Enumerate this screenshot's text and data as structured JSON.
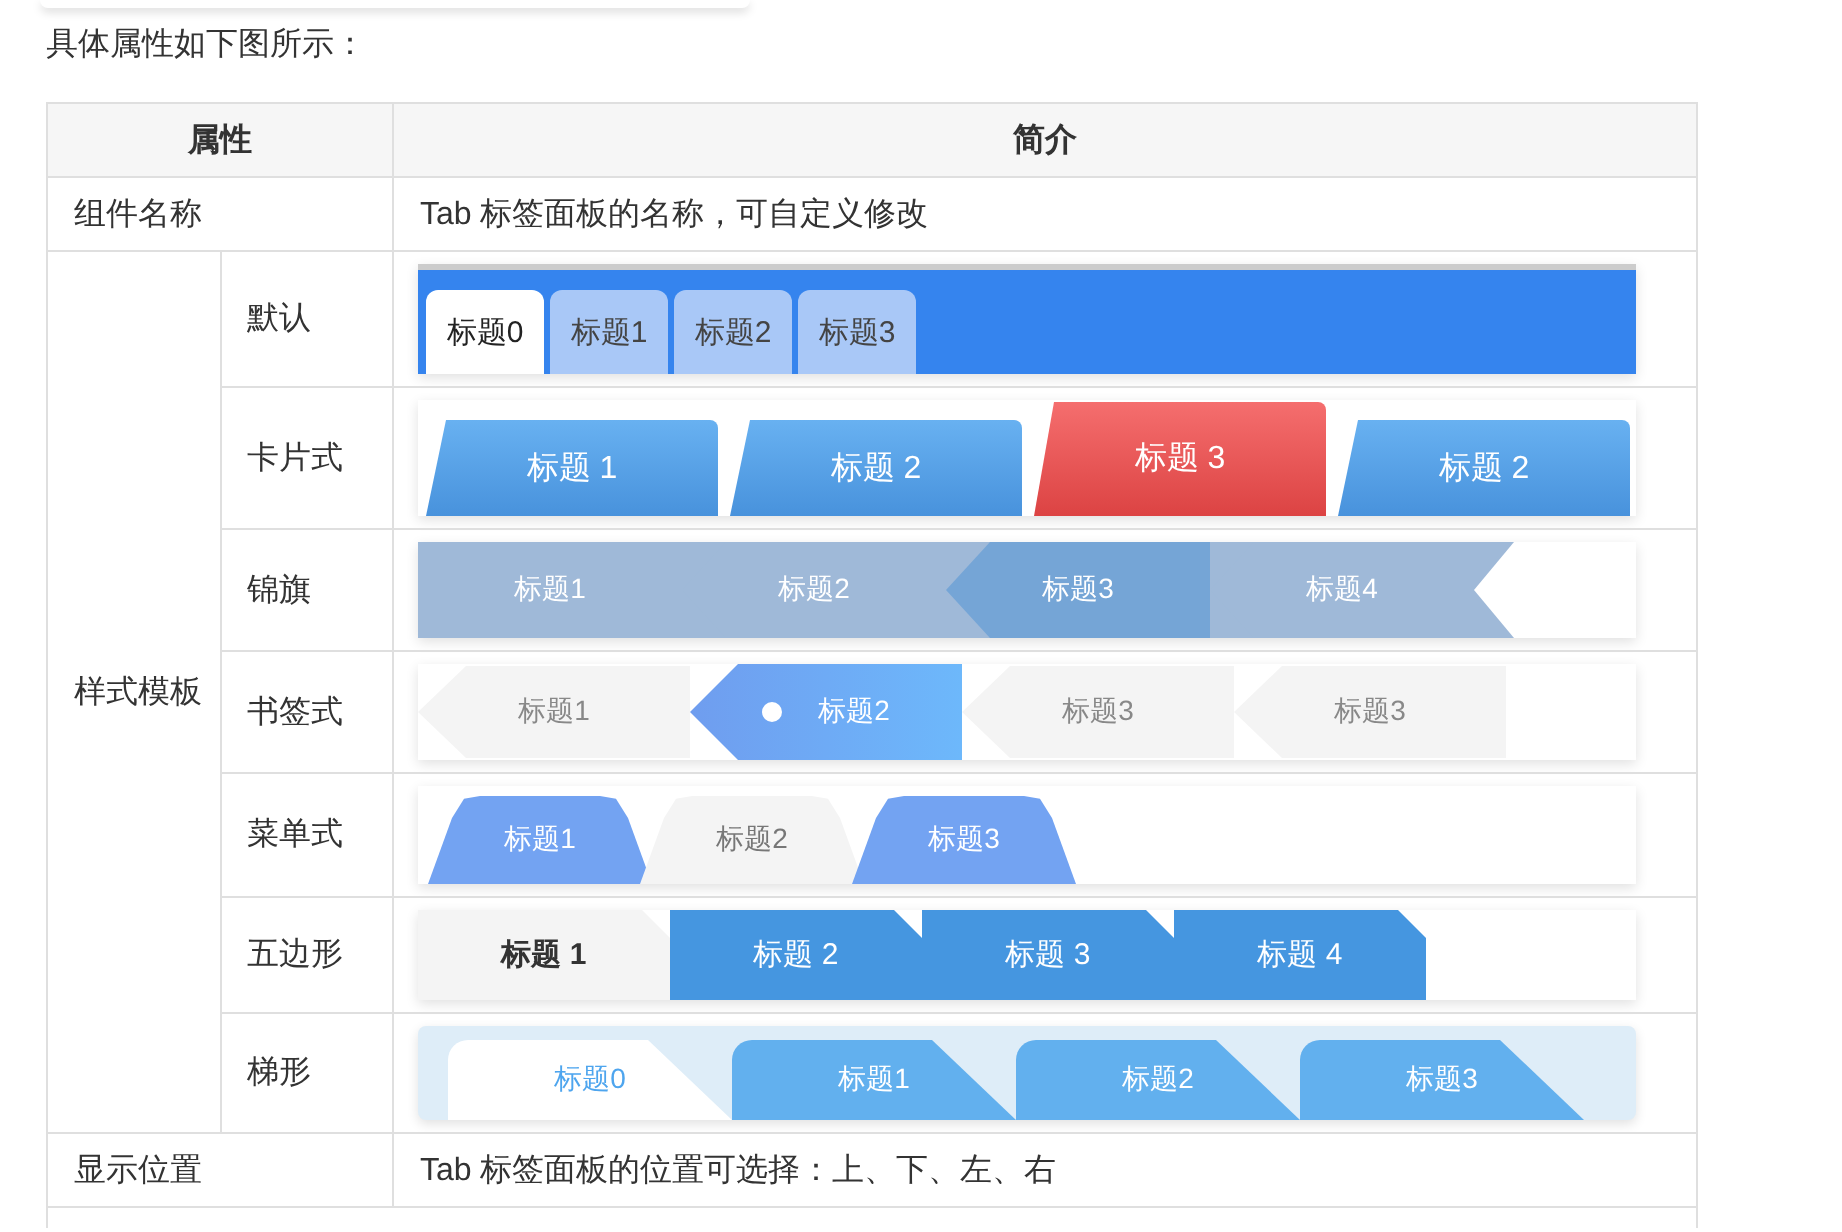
{
  "intro": "具体属性如下图所示：",
  "table": {
    "columns": [
      "属性",
      "简介"
    ],
    "name_row": {
      "property": "组件名称",
      "description": "Tab 标签面板的名称，可自定义修改"
    },
    "template_group": "样式模板",
    "templates": [
      {
        "name": "默认",
        "kind": "default",
        "tabs": [
          {
            "label": "标题0",
            "selected": true
          },
          {
            "label": "标题1",
            "selected": false
          },
          {
            "label": "标题2",
            "selected": false
          },
          {
            "label": "标题3",
            "selected": false
          }
        ]
      },
      {
        "name": "卡片式",
        "kind": "card",
        "tabs": [
          {
            "label": "标题 1",
            "selected": false
          },
          {
            "label": "标题 2",
            "selected": false
          },
          {
            "label": "标题 3",
            "selected": true
          },
          {
            "label": "标题 2",
            "selected": false
          }
        ]
      },
      {
        "name": "锦旗",
        "kind": "flag",
        "tabs": [
          {
            "label": "标题1",
            "selected": false
          },
          {
            "label": "标题2",
            "selected": false
          },
          {
            "label": "标题3",
            "selected": true
          },
          {
            "label": "标题4",
            "selected": false
          }
        ]
      },
      {
        "name": "书签式",
        "kind": "bookmark",
        "tabs": [
          {
            "label": "标题1",
            "selected": false
          },
          {
            "label": "标题2",
            "selected": true
          },
          {
            "label": "标题3",
            "selected": false
          },
          {
            "label": "标题3",
            "selected": false
          }
        ]
      },
      {
        "name": "菜单式",
        "kind": "menu",
        "tabs": [
          {
            "label": "标题1",
            "selected": false
          },
          {
            "label": "标题2",
            "selected": true
          },
          {
            "label": "标题3",
            "selected": false
          }
        ]
      },
      {
        "name": "五边形",
        "kind": "pentagon",
        "tabs": [
          {
            "label": "标题 1",
            "selected": true
          },
          {
            "label": "标题 2",
            "selected": false
          },
          {
            "label": "标题 3",
            "selected": false
          },
          {
            "label": "标题 4",
            "selected": false
          }
        ]
      },
      {
        "name": "梯形",
        "kind": "trapezoid",
        "tabs": [
          {
            "label": "标题0",
            "selected": true
          },
          {
            "label": "标题1",
            "selected": false
          },
          {
            "label": "标题2",
            "selected": false
          },
          {
            "label": "标题3",
            "selected": false
          }
        ]
      }
    ],
    "position_row": {
      "property": "显示位置",
      "description": "Tab 标签面板的位置可选择：上、下、左、右"
    }
  }
}
